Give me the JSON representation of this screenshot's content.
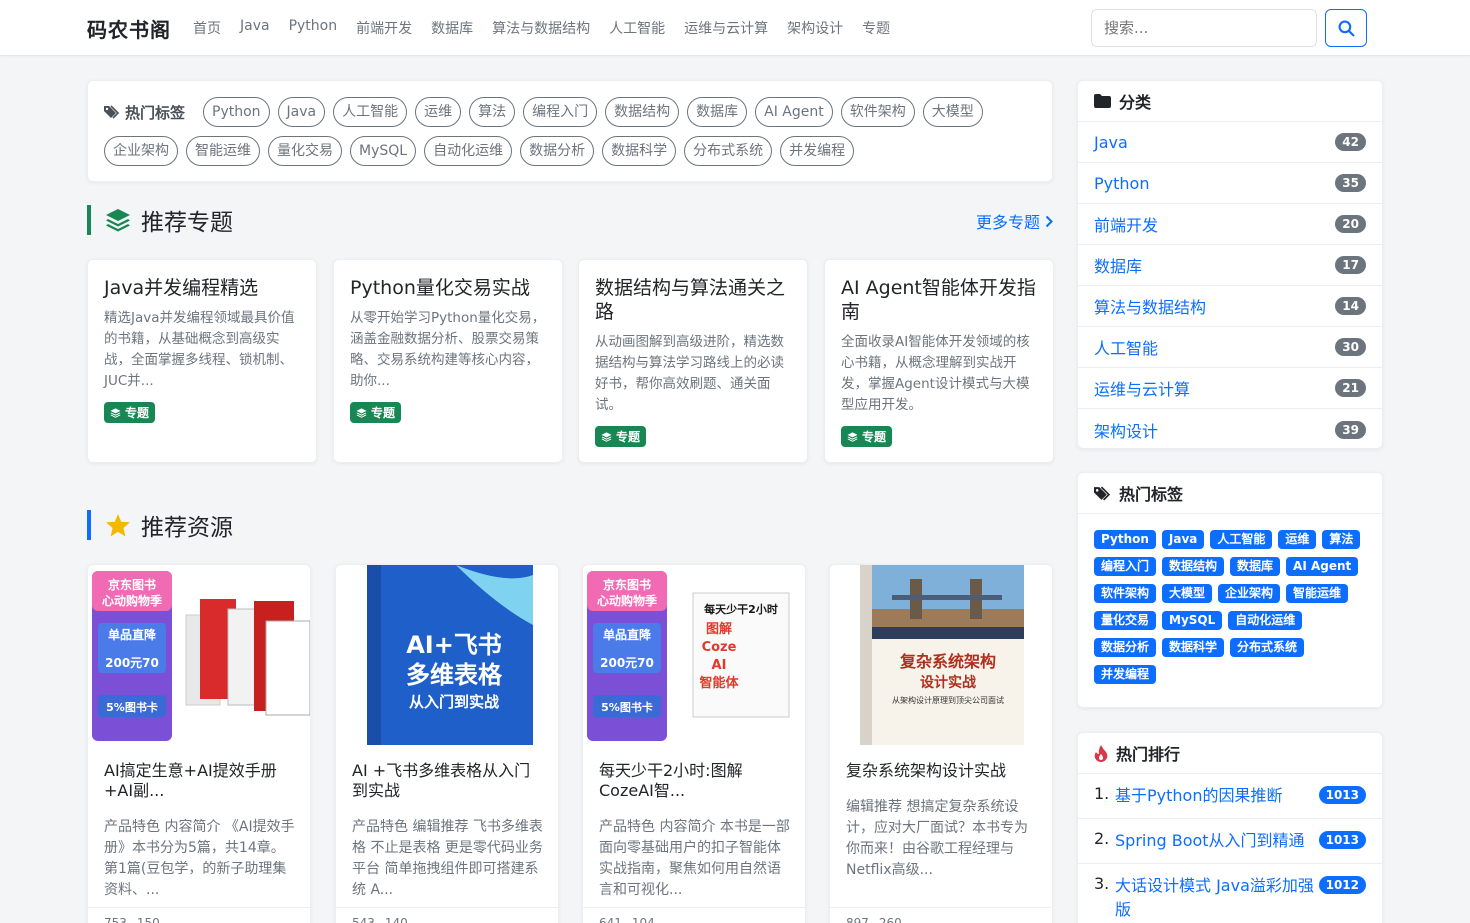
{
  "brand": "码农书阁",
  "nav": [
    "首页",
    "Java",
    "Python",
    "前端开发",
    "数据库",
    "算法与数据结构",
    "人工智能",
    "运维与云计算",
    "架构设计",
    "专题"
  ],
  "search": {
    "placeholder": "搜索..."
  },
  "hot_tags_top": {
    "title": "热门标签",
    "row1": [
      "Python",
      "Java",
      "人工智能",
      "运维",
      "算法",
      "编程入门",
      "数据结构",
      "数据库",
      "AI Agent",
      "软件架构",
      "大模型"
    ],
    "row2": [
      "企业架构",
      "智能运维",
      "量化交易",
      "MySQL",
      "自动化运维",
      "数据分析",
      "数据科学",
      "分布式系统",
      "并发编程"
    ]
  },
  "topics_section": {
    "title": "推荐专题",
    "more": "更多专题"
  },
  "topics": [
    {
      "title": "Java并发编程精选",
      "desc": "精选Java并发编程领域最具价值的书籍，从基础概念到高级实战，全面掌握多线程、锁机制、JUC并...",
      "badge": "专题"
    },
    {
      "title": "Python量化交易实战",
      "desc": "从零开始学习Python量化交易，涵盖金融数据分析、股票交易策略、交易系统构建等核心内容，助你...",
      "badge": "专题"
    },
    {
      "title": "数据结构与算法通关之路",
      "desc": "从动画图解到高级进阶，精选数据结构与算法学习路线上的必读好书，帮你高效刷题、通关面试。",
      "badge": "专题"
    },
    {
      "title": "AI Agent智能体开发指南",
      "desc": "全面收录AI智能体开发领域的核心书籍，从概念理解到实战开发，掌握Agent设计模式与大模型应用开发。",
      "badge": "专题"
    }
  ],
  "resources_section": {
    "title": "推荐资源"
  },
  "resources": [
    {
      "title": "AI搞定生意+AI提效手册+AI副...",
      "desc": "产品特色 内容简介 《AI提效手册》本书分为5篇，共14章。第1篇(豆包学，的新子助理集资料、...",
      "views": "753",
      "downloads": "150",
      "cover_lines": [
        "京东图书",
        "心动购物季",
        "单品直降",
        "200元70",
        "5%图书卡"
      ]
    },
    {
      "title": "AI +飞书多维表格从入门到实战",
      "desc": "产品特色 编辑推荐 飞书多维表格 不止是表格 更是零代码业务平台 简单拖拽组件即可搭建系统 A...",
      "views": "543",
      "downloads": "140",
      "cover_lines": [
        "AI+飞书",
        "多维表格",
        "从入门到实战"
      ]
    },
    {
      "title": "每天少干2小时:图解CozeAI智...",
      "desc": "产品特色 内容简介 本书是一部面向零基础用户的扣子智能体实战指南，聚焦如何用自然语言和可视化...",
      "views": "641",
      "downloads": "104",
      "cover_lines": [
        "京东图书",
        "心动购物季",
        "单品直降",
        "200元70",
        "5%图书卡",
        "每天少干2小时",
        "图解",
        "Coze",
        "AI",
        "智能体"
      ]
    },
    {
      "title": "复杂系统架构设计实战",
      "desc": "编辑推荐 想搞定复杂系统设计，应对大厂面试？本书专为你而来！由谷歌工程经理与Netflix高级...",
      "views": "897",
      "downloads": "260",
      "cover_lines": [
        "复杂系统架构",
        "设计实战",
        "从架构设计原理到顶尖公司面试"
      ]
    }
  ],
  "categories": {
    "title": "分类",
    "items": [
      {
        "name": "Java",
        "count": "42"
      },
      {
        "name": "Python",
        "count": "35"
      },
      {
        "name": "前端开发",
        "count": "20"
      },
      {
        "name": "数据库",
        "count": "17"
      },
      {
        "name": "算法与数据结构",
        "count": "14"
      },
      {
        "name": "人工智能",
        "count": "30"
      },
      {
        "name": "运维与云计算",
        "count": "21"
      },
      {
        "name": "架构设计",
        "count": "39"
      }
    ]
  },
  "side_tags": {
    "title": "热门标签",
    "items": [
      "Python",
      "Java",
      "人工智能",
      "运维",
      "算法",
      "编程入门",
      "数据结构",
      "数据库",
      "AI Agent",
      "软件架构",
      "大模型",
      "企业架构",
      "智能运维",
      "量化交易",
      "MySQL",
      "自动化运维",
      "数据分析",
      "数据科学",
      "分布式系统",
      "并发编程"
    ]
  },
  "ranking": {
    "title": "热门排行",
    "items": [
      {
        "num": "1.",
        "title": "基于Python的因果推断",
        "count": "1013"
      },
      {
        "num": "2.",
        "title": "Spring Boot从入门到精通",
        "count": "1013"
      },
      {
        "num": "3.",
        "title": "大话设计模式 Java溢彩加强版",
        "count": "1012"
      }
    ]
  },
  "colors": {
    "primary": "#0d6efd",
    "success": "#198754",
    "secondary": "#6c757d",
    "star": "#f5b800",
    "fire": "#dc3545"
  }
}
